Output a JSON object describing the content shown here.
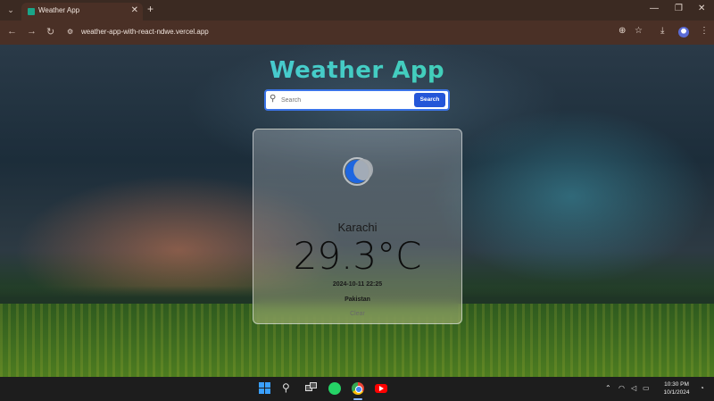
{
  "browser": {
    "tab_title": "Weather App",
    "tab_close": "✕",
    "new_tab": "+",
    "url": "weather-app-with-react-ndwe.vercel.app",
    "controls": {
      "minimize": "—",
      "maximize": "❐",
      "close": "✕"
    },
    "nav": {
      "back": "←",
      "forward": "→",
      "reload": "↻"
    }
  },
  "app": {
    "title": "Weather App",
    "search": {
      "placeholder": "Search",
      "value": "",
      "button_label": "Search"
    },
    "weather": {
      "icon": "moon-icon",
      "city": "Karachi",
      "temperature": "29.3°C",
      "datetime": "2024-10-11 22:25",
      "country": "Pakistan",
      "condition": "Clear"
    }
  },
  "taskbar": {
    "apps": [
      "windows-start-icon",
      "search-icon",
      "task-view-icon",
      "whatsapp-icon",
      "chrome-icon",
      "youtube-icon"
    ],
    "clock_time": "10:30 PM",
    "clock_date": "10/1/2024"
  },
  "colors": {
    "title_gradient_start": "#4fc7ee",
    "title_gradient_end": "#3ad29a",
    "search_button": "#2456d8",
    "moon_icon": "#1e66e0",
    "browser_chrome": "#4a3026"
  }
}
